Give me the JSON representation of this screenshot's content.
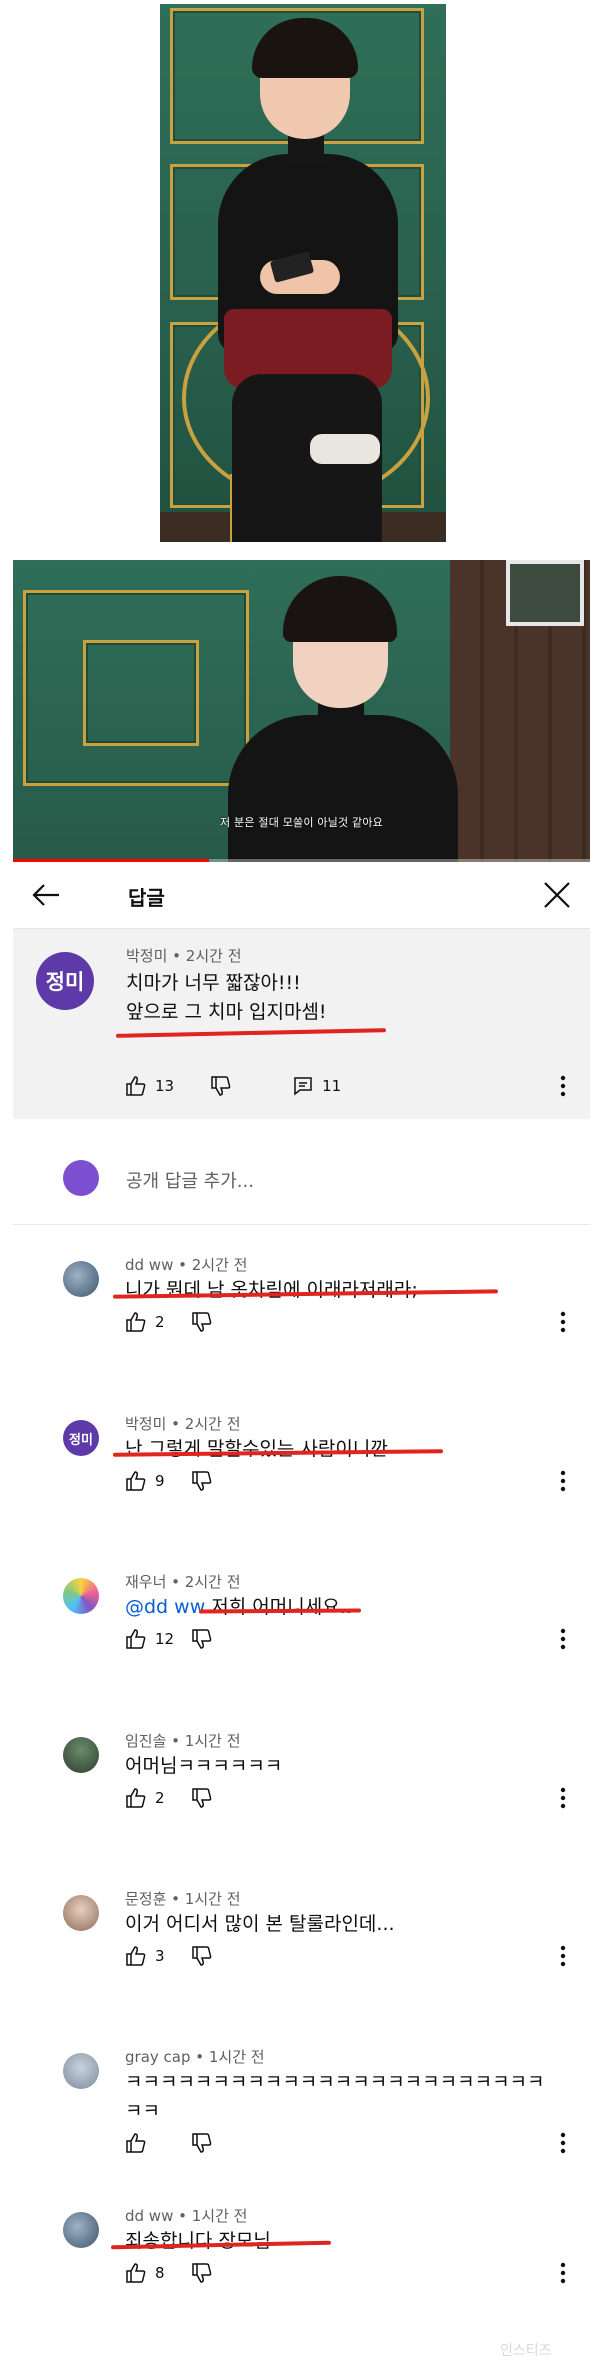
{
  "video": {
    "subtitle": "저 분은 절대 모쏠이 아닐것 같아요",
    "progress": 0.34
  },
  "header": {
    "title": "답글",
    "back_icon": "arrow-left-icon",
    "close_icon": "close-icon"
  },
  "parent_comment": {
    "avatar_text": "정미",
    "avatar_color": "#5d3aa7",
    "author": "박정미",
    "time": "2시간 전",
    "lines": [
      "치마가 너무 짧잖아!!!",
      "앞으로 그 치마 입지마셈!"
    ],
    "likes": "13",
    "replies": "11"
  },
  "reply_input": {
    "placeholder": "공개 답글 추가..."
  },
  "replies": [
    {
      "author": "dd ww",
      "time": "2시간 전",
      "lines": [
        "니가 뭔데 남 옷차림에 이래라저래라;"
      ],
      "likes": "2"
    },
    {
      "author": "박정미",
      "time": "2시간 전",
      "avatar_text": "정미",
      "lines": [
        "난 그렇게 말할수있는 사람이니깐"
      ],
      "likes": "9"
    },
    {
      "author": "재우너",
      "time": "2시간 전",
      "mention": "@dd ww",
      "lines": [
        "저희 어머니세요.."
      ],
      "likes": "12"
    },
    {
      "author": "임진솔",
      "time": "1시간 전",
      "lines": [
        "어머님ㅋㅋㅋㅋㅋㅋ"
      ],
      "likes": "2"
    },
    {
      "author": "문정훈",
      "time": "1시간 전",
      "lines": [
        "이거 어디서 많이 본 탈룰라인데..."
      ],
      "likes": "3"
    },
    {
      "author": "gray cap",
      "time": "1시간 전",
      "lines": [
        "ㅋㅋㅋㅋㅋㅋㅋㅋㅋㅋㅋㅋㅋㅋㅋㅋㅋㅋㅋㅋㅋㅋㅋㅋ",
        "ㅋㅋ"
      ],
      "likes": ""
    },
    {
      "author": "dd ww",
      "time": "1시간 전",
      "lines": [
        "죄송합니다 장모님"
      ],
      "likes": "8"
    }
  ],
  "watermark": "인스티즈",
  "colors": {
    "underline": "#e0241f",
    "mention": "#065fd4",
    "parent_bg": "#f2f2f2"
  }
}
